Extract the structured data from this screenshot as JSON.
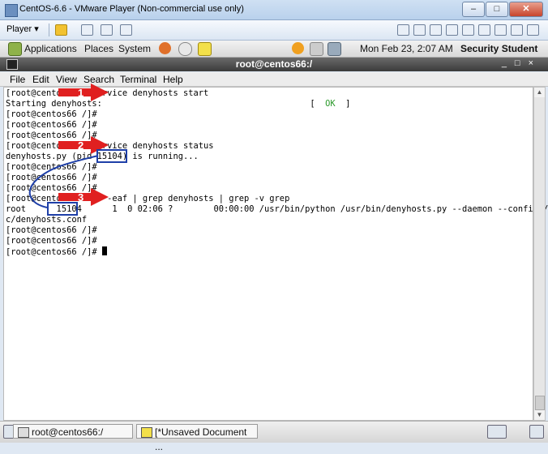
{
  "vmware": {
    "title": "CentOS-6.6 - VMware Player (Non-commercial use only)",
    "player_label": "Player ▾",
    "min_label": "–",
    "max_label": "□",
    "close_label": "✕"
  },
  "panel": {
    "applications": "Applications",
    "places": "Places",
    "system": "System",
    "datetime": "Mon Feb 23,  2:07 AM",
    "user": "Security Student"
  },
  "terminal": {
    "title": "root@centos66:/",
    "controls": "_□×",
    "menu": [
      "File",
      "Edit",
      "View",
      "Search",
      "Terminal",
      "Help"
    ],
    "lines": [
      "[root@cento      service denyhosts start",
      "Starting denyhosts:                                         [  ",
      "[root@centos66 /]#",
      "[root@centos66 /]#",
      "[root@centos66 /]#",
      "[root@cento      service denyhosts status",
      "denyhosts.py (pid 15104) is running...",
      "[root@centos66 /]#",
      "[root@centos66 /]#",
      "[root@centos66 /]#",
      "[root@cento      ps -eaf | grep denyhosts | grep -v grep",
      "root      15104      1  0 02:06 ?        00:00:00 /usr/bin/python /usr/bin/denyhosts.py --daemon --config=/et",
      "c/denyhosts.conf",
      "[root@centos66 /]#",
      "[root@centos66 /]#",
      "[root@centos66 /]# "
    ],
    "ok_text": "OK",
    "ok_suffix": "  ]"
  },
  "annotations": {
    "steps": [
      "1",
      "2",
      "3"
    ],
    "highlight_pid": "15104",
    "arrow_color": "#e02020",
    "box_color": "#1e3fa8"
  },
  "taskbar": {
    "items": [
      "root@centos66:/",
      "[*Unsaved Document ..."
    ]
  }
}
